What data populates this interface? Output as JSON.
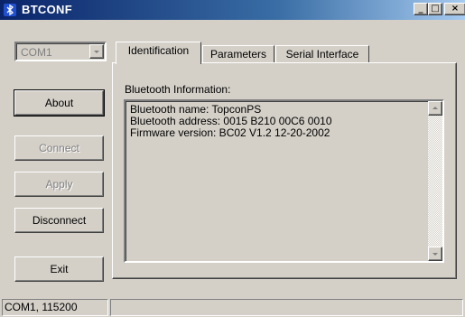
{
  "window": {
    "title": "BTCONF",
    "controls": {
      "minimize": "_",
      "maximize": "□",
      "close": "×"
    }
  },
  "left_panel": {
    "port_combo": {
      "value": "COM1",
      "enabled": false
    },
    "buttons": {
      "about": "About",
      "connect": "Connect",
      "apply": "Apply",
      "disconnect": "Disconnect",
      "exit": "Exit"
    },
    "disabled_buttons": [
      "Connect",
      "Apply"
    ]
  },
  "tabs": [
    {
      "label": "Identification",
      "active": true
    },
    {
      "label": "Parameters",
      "active": false
    },
    {
      "label": "Serial Interface",
      "active": false
    }
  ],
  "identification": {
    "group_label": "Bluetooth Information:",
    "lines": [
      "Bluetooth name: TopconPS",
      "Bluetooth address: 0015 B210 00C6 0010",
      "Firmware version: BC02 V1.2  12-20-2002"
    ]
  },
  "statusbar": {
    "port_info": "COM1, 115200",
    "message": ""
  },
  "colors": {
    "titlebar_start": "#0a246a",
    "titlebar_end": "#a6caf0",
    "face": "#d4d0c8",
    "disabled_text": "#808080"
  }
}
